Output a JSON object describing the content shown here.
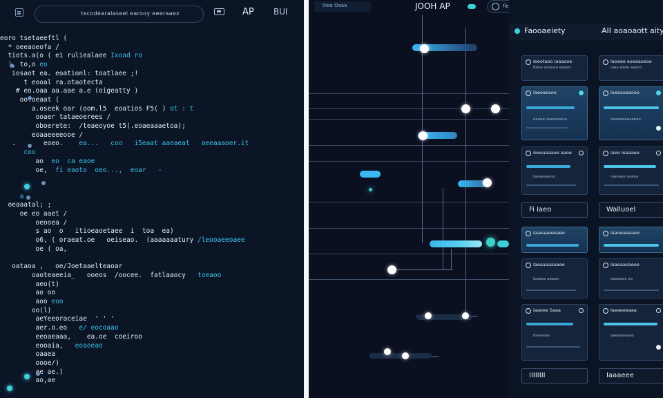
{
  "editor": {
    "search_text": "tecodearalaseel earooy eeeraaex",
    "top_label_ap": "AP",
    "top_label_bu": "BUI",
    "lines": [
      {
        "text": "eoro tsetaeeftl (",
        "accent": ""
      },
      {
        "text": "  * oeeaoeofa /",
        "accent": ""
      },
      {
        "text": "  tiots.a(o ( ei ruliealaee ",
        "accent": "Ixoad ro"
      },
      {
        "text": "  ', to,o ",
        "accent": "eo"
      },
      {
        "text": "   iosaot ea. eoationl: toatlaee ;!",
        "accent": ""
      },
      {
        "text": "      t eooal ra.otaotecta",
        "accent": ""
      },
      {
        "text": "    # eo.oaa aa.aae a.e (oigeatty )",
        "accent": ""
      },
      {
        "text": "     oo.oeaat (",
        "accent": ""
      },
      {
        "text": "        a.oseek oar (oom.l5  eoatios F5( ) ",
        "accent": "ot : t"
      },
      {
        "text": "         ooaer tataeoerees /",
        "accent": ""
      },
      {
        "text": "         oboerete:  /teaeoyoe t5(.eoaeaaaetoa);",
        "accent": ""
      },
      {
        "text": "        eoaaeeeeooe /",
        "accent": ""
      },
      {
        "text": "   .       eoeo.    ",
        "accent": "ea...   coo   i5eaat aaeaeat   aeeaaaoer.it"
      },
      {
        "text": "      ",
        "accent": "coo"
      },
      {
        "text": "         ao  ",
        "accent": "eo  ca eaoe"
      },
      {
        "text": "         oe,  ",
        "accent": "fi eaoto  oeo...,  eoar   -"
      },
      {
        "text": "",
        "accent": ""
      },
      {
        "text": "",
        "accent": ""
      },
      {
        "text": "     ",
        "accent": "a"
      },
      {
        "text": "  oeaaatal; ;",
        "accent": ""
      },
      {
        "text": "     oe eo aaet /",
        "accent": ""
      },
      {
        "text": "         oeooea /",
        "accent": ""
      },
      {
        "text": "         s ao  o   itioeaoetaee  i  toa  ea)",
        "accent": ""
      },
      {
        "text": "         o6, ( oraeat.oe   oeiseao.  (aaaaaaatury ",
        "accent": "/leooaeeoaee"
      },
      {
        "text": "         oe ( oa,",
        "accent": ""
      },
      {
        "text": "",
        "accent": ""
      },
      {
        "text": "   oataoa ,   oe/Joetaaelteaoar",
        "accent": ""
      },
      {
        "text": "        oaoteaeeia_   ooeos  /oocee.  fatlaaocy   ",
        "accent": "toeaoo"
      },
      {
        "text": "         aeo(t)",
        "accent": ""
      },
      {
        "text": "         ao oo",
        "accent": ""
      },
      {
        "text": "         aoo ",
        "accent": "eoo"
      },
      {
        "text": "        oo(l)",
        "accent": ""
      },
      {
        "text": "         aeYeeoraceiae  ' ' '",
        "accent": ""
      },
      {
        "text": "         aer.o.eo   ",
        "accent": "e/ eocoaao"
      },
      {
        "text": "         eeoaeaaa,    ea.oe  coeiroo",
        "accent": ""
      },
      {
        "text": "         eooaia,   ",
        "accent": "eoaoeao"
      },
      {
        "text": "         oaaea",
        "accent": ""
      },
      {
        "text": "         oooe/)",
        "accent": ""
      },
      {
        "text": "         ae ae.)",
        "accent": ""
      },
      {
        "text": "         ao,ae",
        "accent": ""
      }
    ]
  },
  "timeline": {
    "tab_label": "IIIoe  Oaaa",
    "title": "JOOH AP",
    "search_text": "fleesoo eeeoaooaaaeeo"
  },
  "activity": {
    "title": "Faooaeiety",
    "filter": "AII aoaoaott aity -",
    "cards": [
      {
        "title": "Ieeotaeo Iaaaooe",
        "sub": "Beee aaooaa eaaao"
      },
      {
        "title": "Iaoaee eooeaoeoe",
        "sub": "Iaaa eaee aaaoo"
      },
      {
        "title": "Iaeeaeaoe",
        "sub": "eaaee aaeeaaeoa"
      },
      {
        "title": "Iaeeaoaeoeo",
        "sub": "aaaaeeeaaaeeo"
      },
      {
        "title": "Ieeeaaaaee aaoe",
        "sub": "Iaeaeaaeoo"
      },
      {
        "title": "Iaeo Ieaaaee",
        "sub": "Iaaeaee aaeoa"
      },
      {
        "title": "Iaaeaaeeeaee",
        "sub": "Ioaeeae ooa"
      },
      {
        "title": "Iaaoeaeeaeo",
        "sub": "aaoeeoeaea"
      },
      {
        "title": "Iaeaaaaaaaee",
        "sub": "Iaaaee aeeao"
      },
      {
        "title": "Iaaeaaeaeee",
        "sub": "eaaeaee oo"
      },
      {
        "title": "Iaaoee Saaa",
        "sub": "Baeeeae"
      },
      {
        "title": "Iaeaeeeaaa",
        "sub": "aaeeeaeaao"
      }
    ],
    "tags": [
      "Fi Iaeo",
      "Walluoel",
      "IIIIIIII",
      "Iaaaeee"
    ]
  }
}
